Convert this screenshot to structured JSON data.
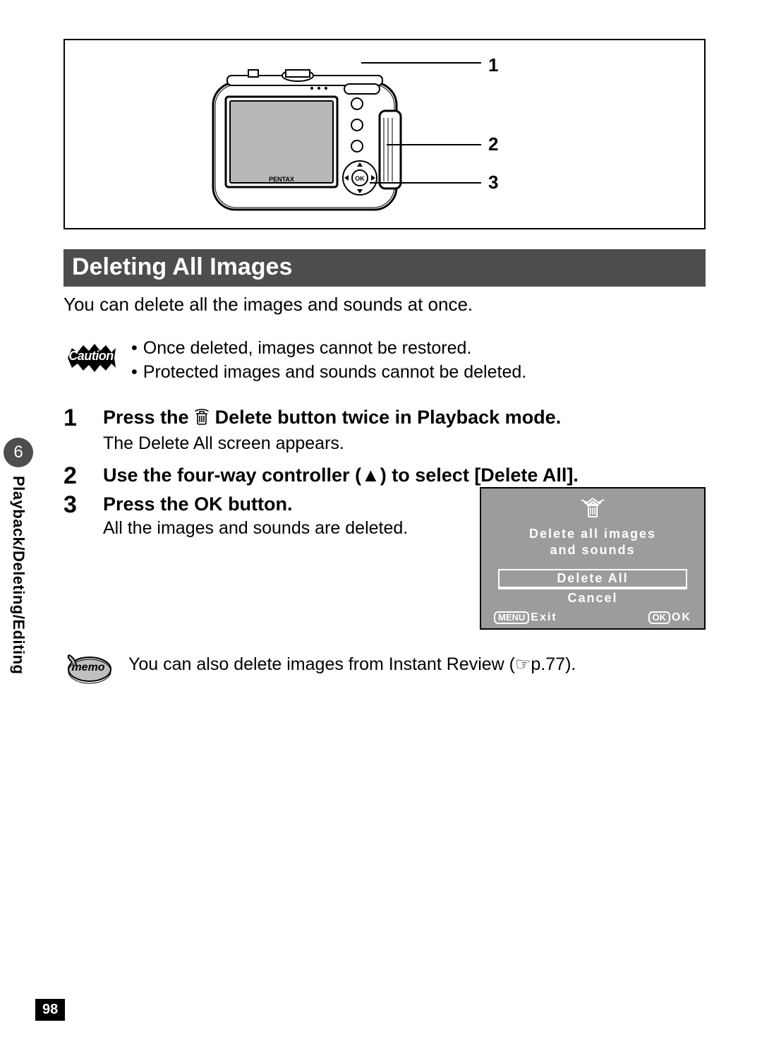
{
  "diagram": {
    "brand": "PENTAX",
    "callouts": [
      "1",
      "2",
      "3"
    ]
  },
  "section_title": "Deleting All Images",
  "intro": "You can delete all the images and sounds at once.",
  "caution": {
    "label": "Caution",
    "items": [
      "Once deleted, images cannot be restored.",
      "Protected images and sounds cannot be deleted."
    ]
  },
  "steps": [
    {
      "num": "1",
      "heading_pre": "Press the ",
      "heading_post": " Delete button twice in Playback mode.",
      "sub": "The Delete All screen appears."
    },
    {
      "num": "2",
      "heading": "Use the four-way controller (▲) to select [Delete All]."
    },
    {
      "num": "3",
      "heading": "Press the OK button.",
      "sub": "All the images and sounds are deleted."
    }
  ],
  "lcd": {
    "msg_line1": "Delete all images",
    "msg_line2": "and sounds",
    "option_selected": "Delete All",
    "option_other": "Cancel",
    "menu_pill": "MENU",
    "menu_text": "Exit",
    "ok_pill": "OK",
    "ok_text": "OK"
  },
  "memo": {
    "label": "memo",
    "text_pre": "You can also delete images from Instant Review (",
    "page_ref": "☞p.77",
    "text_post": ")."
  },
  "side": {
    "chapter": "6",
    "label": "Playback/Deleting/Editing"
  },
  "page_number": "98"
}
